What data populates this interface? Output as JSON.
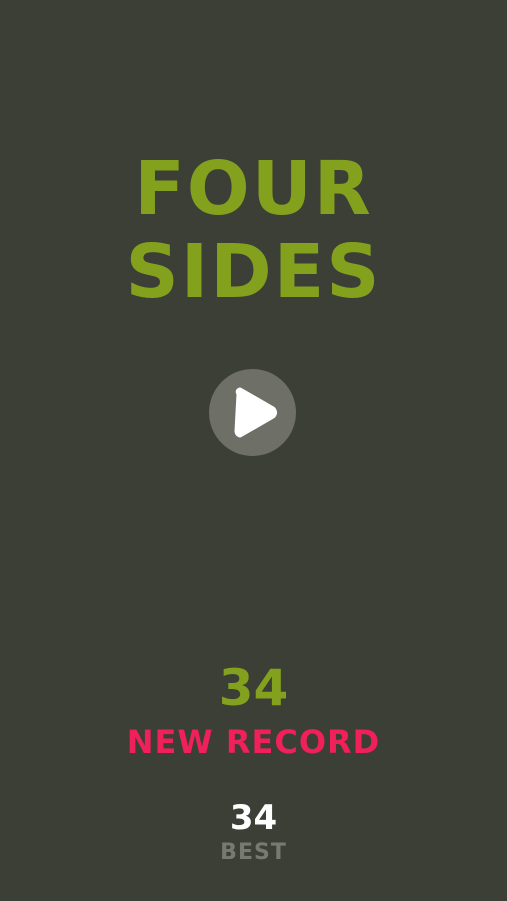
{
  "game": {
    "title_line1": "FOUR",
    "title_line2": "SIDES"
  },
  "controls": {
    "play_icon": "play-icon"
  },
  "results": {
    "score": "34",
    "record_label": "NEW RECORD",
    "best_score": "34",
    "best_label": "BEST"
  },
  "colors": {
    "background": "#3c3f36",
    "accent_green": "#84a11e",
    "record_pink": "#f0205a",
    "muted_gray": "#767a6f"
  }
}
